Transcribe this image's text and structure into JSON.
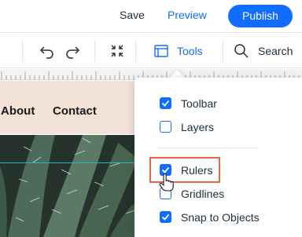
{
  "header": {
    "save_label": "Save",
    "preview_label": "Preview",
    "publish_label": "Publish"
  },
  "toolbar": {
    "tools_label": "Tools",
    "search_label": "Search"
  },
  "site": {
    "nav_items": [
      "About",
      "Contact"
    ]
  },
  "tools_menu": {
    "items": [
      {
        "label": "Toolbar",
        "checked": true
      },
      {
        "label": "Layers",
        "checked": false
      },
      {
        "label": "Rulers",
        "checked": true
      },
      {
        "label": "Gridlines",
        "checked": false
      },
      {
        "label": "Snap to Objects",
        "checked": true
      }
    ]
  },
  "colors": {
    "accent": "#116dff",
    "highlight": "#e8644c",
    "header_bg": "#f3e2d8"
  }
}
